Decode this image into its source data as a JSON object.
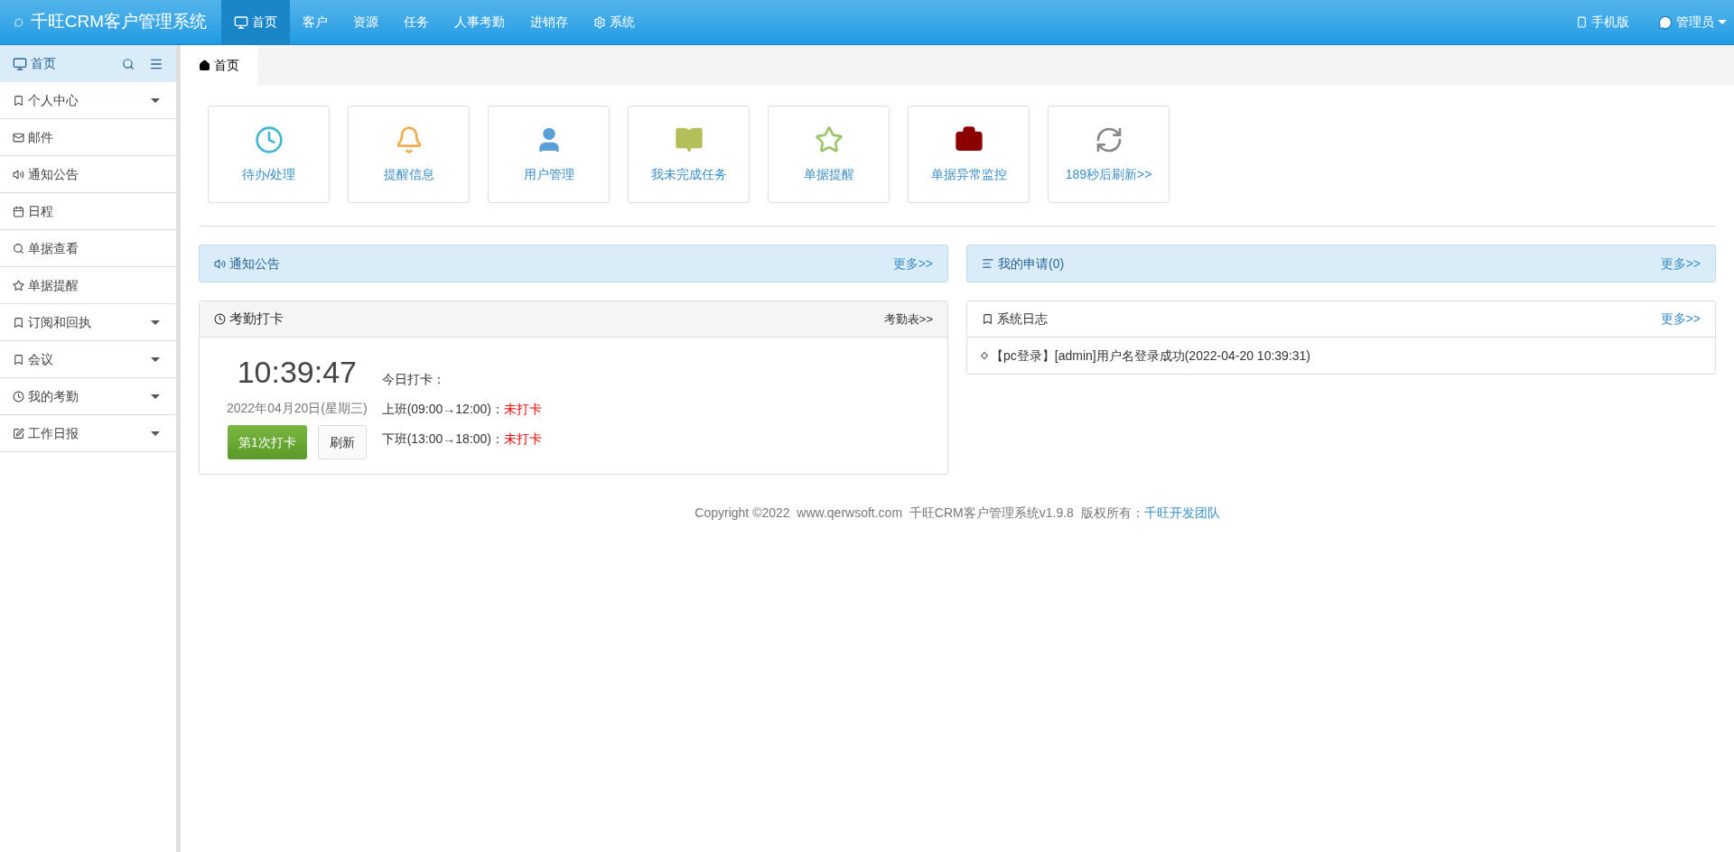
{
  "app_title": "千旺CRM客户管理系统",
  "nav": [
    {
      "label": "首页",
      "selected": true
    },
    {
      "label": "客户",
      "selected": false
    },
    {
      "label": "资源",
      "selected": false
    },
    {
      "label": "任务",
      "selected": false
    },
    {
      "label": "人事考勤",
      "selected": false
    },
    {
      "label": "进销存",
      "selected": false
    },
    {
      "label": "系统",
      "selected": false
    }
  ],
  "top_right": {
    "mobile": "手机版",
    "user": "管理员"
  },
  "sidebar": {
    "title": "首页",
    "items": [
      {
        "label": "个人中心",
        "expandable": true
      },
      {
        "label": "邮件",
        "expandable": false
      },
      {
        "label": "通知公告",
        "expandable": false
      },
      {
        "label": "日程",
        "expandable": false
      },
      {
        "label": "单据查看",
        "expandable": false
      },
      {
        "label": "单据提醒",
        "expandable": false
      },
      {
        "label": "订阅和回执",
        "expandable": true
      },
      {
        "label": "会议",
        "expandable": true
      },
      {
        "label": "我的考勤",
        "expandable": true
      },
      {
        "label": "工作日报",
        "expandable": true
      }
    ]
  },
  "tabs": [
    {
      "label": "首页",
      "selected": true
    }
  ],
  "shortcuts": [
    {
      "label": "待办/处理",
      "color": "#3fb6d6"
    },
    {
      "label": "提醒信息",
      "color": "#f0ad4e"
    },
    {
      "label": "用户管理",
      "color": "#5a9fd8"
    },
    {
      "label": "我未完成任务",
      "color": "#b5bf5a"
    },
    {
      "label": "单据提醒",
      "color": "#9cc46a"
    },
    {
      "label": "单据异常监控",
      "color": "#8b0000"
    },
    {
      "label": "189秒后刷新>>",
      "color": "#888888"
    }
  ],
  "notice_panel": {
    "title": "通知公告",
    "more": "更多>>"
  },
  "request_panel": {
    "title": "我的申请(0)",
    "more": "更多>>"
  },
  "attendance": {
    "title": "考勤打卡",
    "link": "考勤表>>",
    "time": "10:39:47",
    "date": "2022年04月20日(星期三)",
    "punch_button": "第1次打卡",
    "refresh_button": "刷新",
    "today_label": "今日打卡：",
    "shifts": [
      {
        "label": "上班(09:00→12:00)：",
        "status": "未打卡"
      },
      {
        "label": "下班(13:00→18:00)：",
        "status": "未打卡"
      }
    ]
  },
  "log_panel": {
    "title": "系统日志",
    "more": "更多>>",
    "entries": [
      "【pc登录】[admin]用户名登录成功(2022-04-20 10:39:31)"
    ]
  },
  "footer": {
    "text": "Copyright ©2022  www.qerwsoft.com  千旺CRM客户管理系统v1.9.8  版权所有：",
    "link": "千旺开发团队"
  }
}
